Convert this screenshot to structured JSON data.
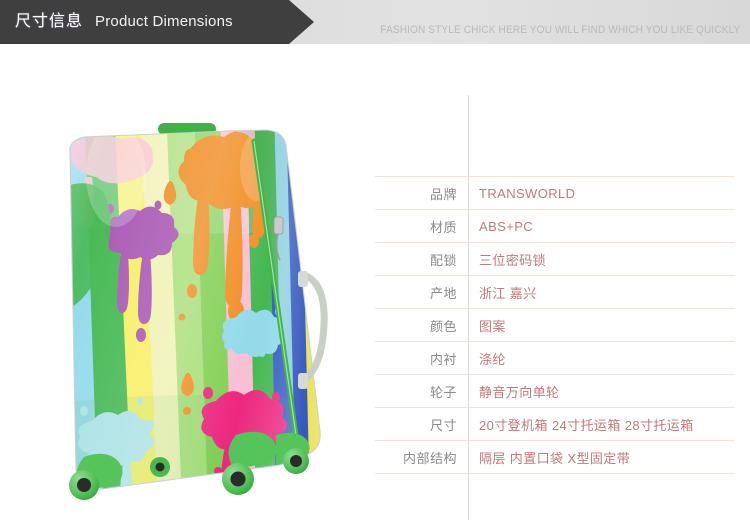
{
  "header": {
    "title_cn": "尺寸信息",
    "title_en": "Product Dimensions",
    "tagline": "FASHION STYLE CHICK HERE YOU WILL FIND WHICH YOU LIKE QUICKLY",
    "band_dark_color": "#3f3f40",
    "band_light_color": "#dcdcdc",
    "title_color": "#ffffff",
    "tagline_color": "#b9b9b9"
  },
  "product_image": {
    "alt": "Rainbow striped paint-splatter hardshell spinner suitcase",
    "shell_stripe_colors": [
      "#7fd4e8",
      "#3cb54a",
      "#f3ec52",
      "#eef0a8",
      "#9fd86a",
      "#f7b9cf",
      "#3cb54a",
      "#f9a8c4",
      "#2f56c6",
      "#f3ec52",
      "#f7b9cf"
    ],
    "splatter_colors": {
      "orange": "#f08a1c",
      "purple": "#b champion",
      "magenta": "#ec1e79",
      "cyan": "#8fd8e8",
      "violet": "#a54fb0"
    },
    "wheel_color": "#55c45a",
    "zipper_color": "#41b649"
  },
  "spec_table": {
    "divider_color": "#e8d7cf",
    "row_line_color": "#f0e3dc",
    "label_color": "#8a8a8a",
    "value_color": "#c2787c",
    "rows": [
      {
        "label": "品牌",
        "value": "TRANSWORLD"
      },
      {
        "label": "材质",
        "value": "ABS+PC"
      },
      {
        "label": "配锁",
        "value": "三位密码锁"
      },
      {
        "label": "产地",
        "value": "浙江  嘉兴"
      },
      {
        "label": "颜色",
        "value": "图案"
      },
      {
        "label": "内衬",
        "value": "涤纶"
      },
      {
        "label": "轮子",
        "value": "静音万向单轮"
      },
      {
        "label": "尺寸",
        "value": "20寸登机箱   24寸托运箱   28寸托运箱"
      },
      {
        "label": "内部结构",
        "value": "隔层 内置口袋 X型固定带"
      }
    ]
  }
}
